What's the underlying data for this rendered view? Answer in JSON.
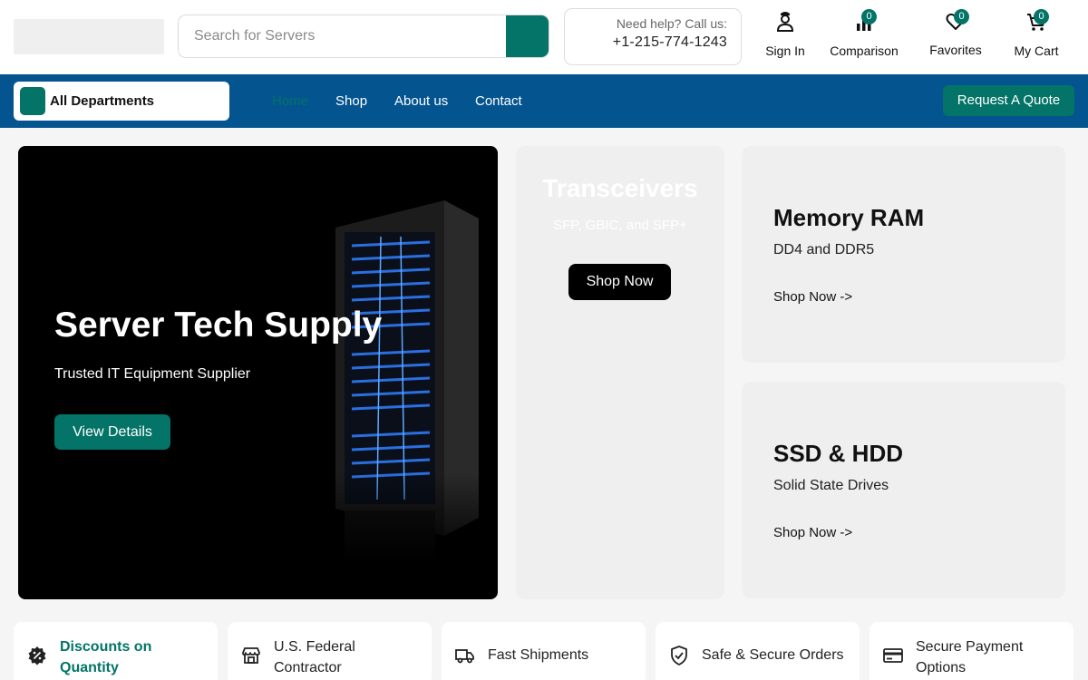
{
  "header": {
    "search_placeholder": "Search for Servers",
    "help_label": "Need help? Call us:",
    "help_phone": "+1-215-774-1243",
    "icons": [
      {
        "label": "Sign In",
        "icon": "user-icon"
      },
      {
        "label": "Comparison",
        "icon": "bar-chart-icon",
        "badge": "0"
      },
      {
        "label": "Favorites",
        "icon": "heart-icon",
        "badge": "0"
      },
      {
        "label": "My Cart",
        "icon": "cart-icon",
        "badge": "0"
      }
    ]
  },
  "nav": {
    "departments_label": "All Departments",
    "links": [
      "Home",
      "Shop",
      "About us",
      "Contact"
    ],
    "active_link": "Home",
    "quote_label": "Request A Quote"
  },
  "hero": {
    "title": "Server Tech Supply",
    "subtitle": "Trusted IT Equipment Supplier",
    "button_label": "View Details"
  },
  "cards": {
    "transceivers": {
      "title": "Transceivers",
      "subtitle": "SFP, GBIC, and SFP+",
      "button_label": "Shop Now"
    },
    "memory": {
      "title": "Memory RAM",
      "subtitle": "DD4 and DDR5",
      "link_label": "Shop Now ->"
    },
    "storage": {
      "title": "SSD & HDD",
      "subtitle": "Solid State Drives",
      "link_label": "Shop Now ->"
    }
  },
  "features": [
    {
      "line1": "Discounts on",
      "line2": "Quantity",
      "icon": "discount-badge-icon"
    },
    {
      "line1": "U.S. Federal",
      "line2": "Contractor",
      "icon": "store-icon"
    },
    {
      "line1": "Fast Shipments",
      "line2": "",
      "icon": "truck-icon"
    },
    {
      "line1": "Safe & Secure Orders",
      "line2": "",
      "icon": "shield-check-icon"
    },
    {
      "line1": "Secure Payment",
      "line2": "Options",
      "icon": "credit-card-icon"
    }
  ],
  "colors": {
    "accent": "#037467",
    "nav_background": "#04548f",
    "page_background": "#f5f5f5",
    "card_background": "#efefef"
  }
}
